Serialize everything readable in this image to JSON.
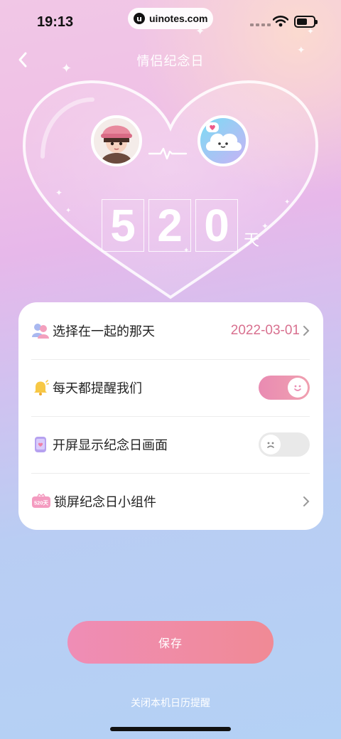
{
  "status_bar": {
    "time": "19:13",
    "url": "uinotes.com",
    "url_logo": "u",
    "icons": [
      "signal-dots-icon",
      "wifi-icon",
      "battery-icon"
    ]
  },
  "nav": {
    "title": "情侣纪念日",
    "back_icon": "chevron-left-icon"
  },
  "hero": {
    "avatars": [
      "girl-avatar",
      "cloud-character-avatar"
    ],
    "digits": [
      "5",
      "2",
      "0"
    ],
    "unit": "天"
  },
  "settings": {
    "rows": [
      {
        "label": "选择在一起的那天",
        "value": "2022-03-01",
        "icon": "couple-icon"
      },
      {
        "label": "每天都提醒我们",
        "icon": "bell-icon",
        "toggle": "on"
      },
      {
        "label": "开屏显示纪念日画面",
        "icon": "phone-heart-icon",
        "toggle": "off"
      },
      {
        "label": "锁屏纪念日小组件",
        "icon": "widget-icon",
        "badge": "520天"
      }
    ]
  },
  "actions": {
    "save_label": "保存",
    "close_link": "关闭本机日历提醒"
  },
  "colors": {
    "accent": "#d8708f",
    "toggle_on": "#e98bb2",
    "button": "#ef8db6"
  }
}
